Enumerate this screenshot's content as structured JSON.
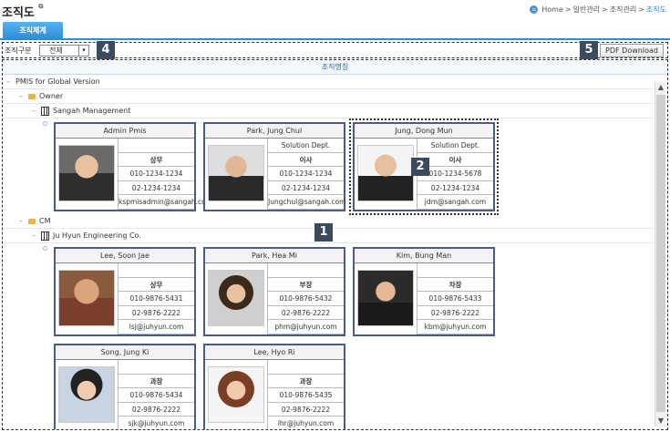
{
  "header": {
    "title": "조직도",
    "title_icon": "link-icon",
    "breadcrumb": [
      "Home",
      "일반관리",
      "조직관리",
      "조직도"
    ],
    "breadcrumb_sep": ">"
  },
  "tabs": [
    {
      "label": "조직체계",
      "active": true
    }
  ],
  "toolbar": {
    "select_label": "조직구분",
    "select_value": "전체",
    "pdf_button": "PDF Download"
  },
  "badges": [
    "1",
    "2",
    "4",
    "5"
  ],
  "org_panel": {
    "header": "조직명칭",
    "root": "PMIS for Global Version",
    "groups": [
      {
        "name": "Owner",
        "company": "Sangah Management"
      },
      {
        "name": "CM",
        "company": "Ju Hyun Engineering Co."
      }
    ]
  },
  "people": [
    {
      "name": "Admin Pmis",
      "dept": "",
      "rank": "상무",
      "mobile": "010-1234-1234",
      "phone": "02-1234-1234",
      "email": "kspmisadmin@sangah.com"
    },
    {
      "name": "Park, Jung Chul",
      "dept": "Solution Dept.",
      "rank": "이사",
      "mobile": "010-1234-1234",
      "phone": "02-1234-1234",
      "email": "Jungchul@sangah.com"
    },
    {
      "name": "Jung, Dong Mun",
      "dept": "Solution Dept.",
      "rank": "이사",
      "mobile": "010-1234-5678",
      "phone": "02-1234-1234",
      "email": "jdm@sangah.com"
    },
    {
      "name": "Lee, Soon Jae",
      "dept": "",
      "rank": "상무",
      "mobile": "010-9876-5431",
      "phone": "02-9876-2222",
      "email": "lsj@juhyun.com"
    },
    {
      "name": "Park, Hea Mi",
      "dept": "",
      "rank": "부장",
      "mobile": "010-9876-5432",
      "phone": "02-9876-2222",
      "email": "phm@juhyun.com"
    },
    {
      "name": "Kim, Bung Man",
      "dept": "",
      "rank": "차장",
      "mobile": "010-9876-5433",
      "phone": "02-9876-2222",
      "email": "kbm@juhyun.com"
    },
    {
      "name": "Song, Jung Ki",
      "dept": "",
      "rank": "과장",
      "mobile": "010-9876-5434",
      "phone": "02-9876-2222",
      "email": "sjk@juhyun.com"
    },
    {
      "name": "Lee, Hyo Ri",
      "dept": "",
      "rank": "과장",
      "mobile": "010-9876-5435",
      "phone": "02-9876-2222",
      "email": "lhr@juhyun.com"
    }
  ]
}
